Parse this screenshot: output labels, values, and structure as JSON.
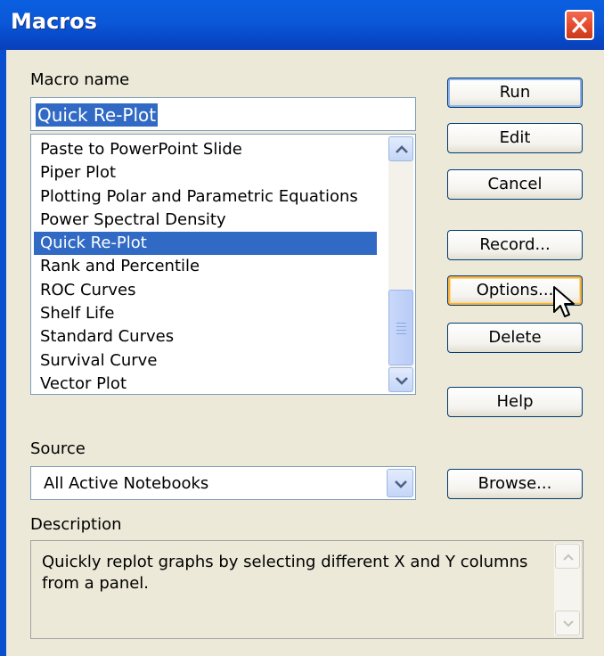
{
  "window": {
    "title": "Macros"
  },
  "macro_name": {
    "label": "Macro name",
    "value": "Quick Re-Plot"
  },
  "macro_list": {
    "items": [
      "Paste to PowerPoint Slide",
      "Piper Plot",
      "Plotting Polar and Parametric Equations",
      "Power Spectral Density",
      "Quick Re-Plot",
      "Rank and Percentile",
      "ROC Curves",
      "Shelf Life",
      "Standard Curves",
      "Survival Curve",
      "Vector Plot"
    ],
    "selected_index": 4
  },
  "buttons": {
    "run": "Run",
    "edit": "Edit",
    "cancel": "Cancel",
    "record": "Record...",
    "options": "Options...",
    "delete": "Delete",
    "help": "Help",
    "browse": "Browse..."
  },
  "source": {
    "label": "Source",
    "value": "All Active Notebooks"
  },
  "description": {
    "label": "Description",
    "text": "Quickly replot graphs by selecting different X and Y columns from a panel."
  },
  "colors": {
    "titlebar": "#0A5FE0",
    "selection": "#316AC5",
    "dialog_bg": "#ECE9D8",
    "hover_border": "#F8B33F"
  },
  "icons": {
    "close": "close-icon",
    "scroll_up": "chevron-up-icon",
    "scroll_down": "chevron-down-icon",
    "dropdown": "chevron-down-icon",
    "cursor": "mouse-pointer-icon"
  }
}
